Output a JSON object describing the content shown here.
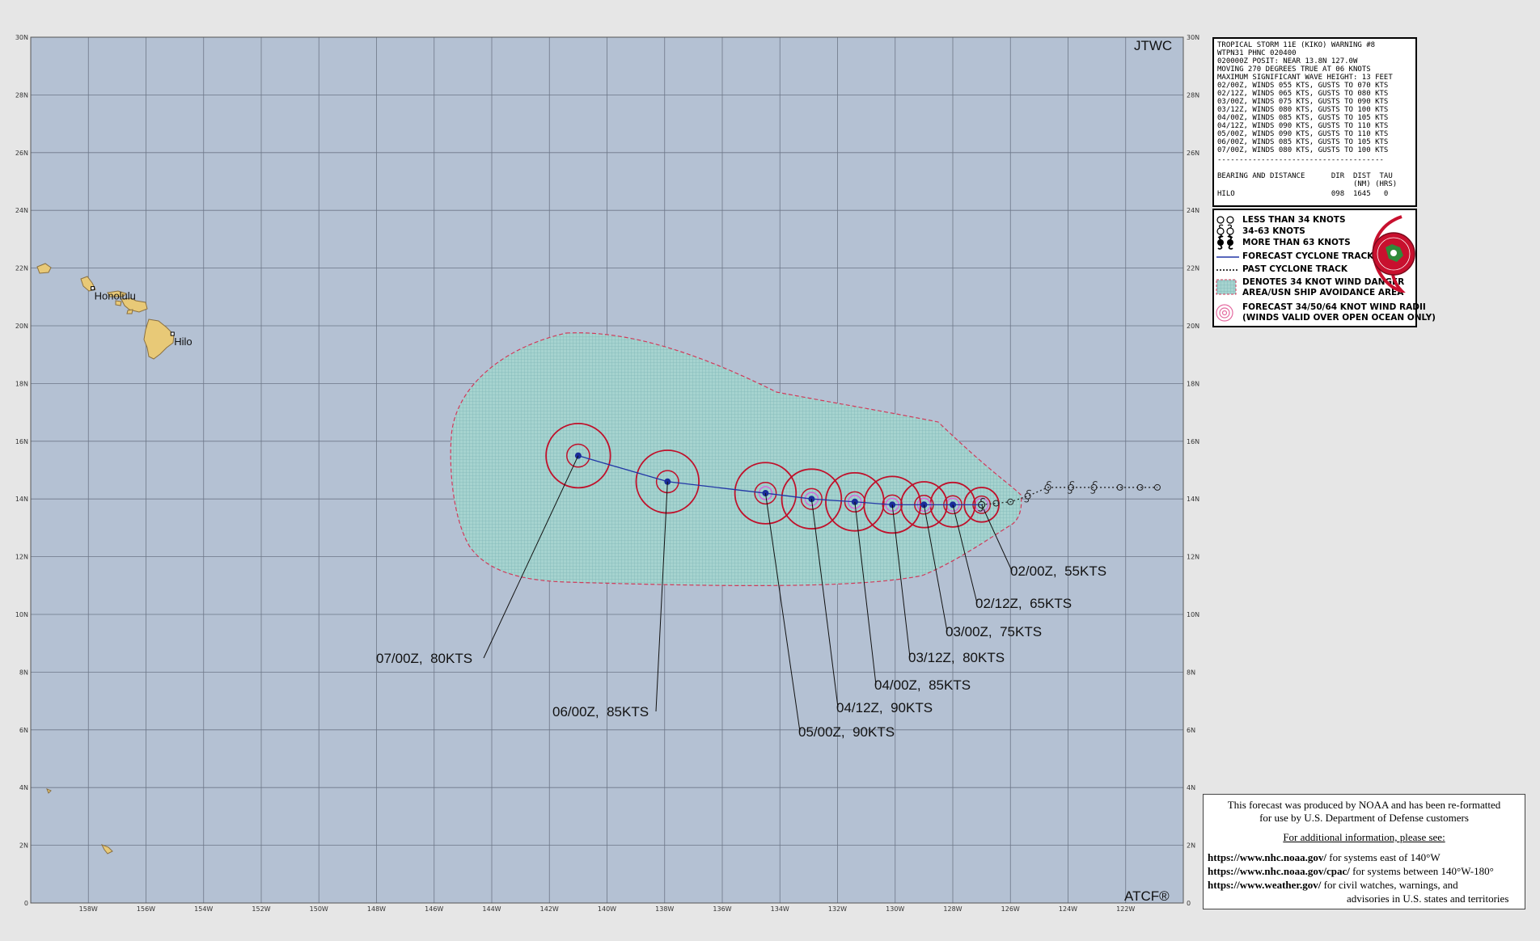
{
  "map": {
    "agency_label": "JTWC",
    "atcf_label": "ATCF®",
    "lat_labels": [
      "0",
      "2N",
      "4N",
      "6N",
      "8N",
      "10N",
      "12N",
      "14N",
      "16N",
      "18N",
      "20N",
      "22N",
      "24N",
      "26N",
      "28N",
      "30N"
    ],
    "lon_labels": [
      "158W",
      "156W",
      "154W",
      "152W",
      "150W",
      "148W",
      "146W",
      "144W",
      "142W",
      "140W",
      "138W",
      "136W",
      "134W",
      "132W",
      "130W",
      "128W",
      "126W",
      "124W",
      "122W"
    ],
    "lon_range": [
      -160,
      -120
    ],
    "lat_range": [
      0,
      30
    ],
    "places": [
      {
        "name": "Honolulu",
        "lat": 21.3,
        "lon": -157.85
      },
      {
        "name": "Hilo",
        "lat": 19.72,
        "lon": -155.08
      }
    ],
    "colors": {
      "ocean": "#b4c1d3",
      "land": "#e8c977",
      "danger_area": "#9fd0cc",
      "track": "#2236a6",
      "radii": "#c0102a"
    }
  },
  "forecast_track": [
    {
      "label": "02/00Z,  55KTS",
      "lat": 13.8,
      "lon": -127.0,
      "kts": 55
    },
    {
      "label": "02/12Z,  65KTS",
      "lat": 13.8,
      "lon": -128.0,
      "kts": 65
    },
    {
      "label": "03/00Z,  75KTS",
      "lat": 13.8,
      "lon": -129.0,
      "kts": 75
    },
    {
      "label": "03/12Z,  80KTS",
      "lat": 13.8,
      "lon": -130.1,
      "kts": 80
    },
    {
      "label": "04/00Z,  85KTS",
      "lat": 13.9,
      "lon": -131.4,
      "kts": 85
    },
    {
      "label": "04/12Z,  90KTS",
      "lat": 14.0,
      "lon": -132.9,
      "kts": 90
    },
    {
      "label": "05/00Z,  90KTS",
      "lat": 14.2,
      "lon": -134.5,
      "kts": 90
    },
    {
      "label": "06/00Z,  85KTS",
      "lat": 14.6,
      "lon": -137.9,
      "kts": 85
    },
    {
      "label": "07/00Z,  80KTS",
      "lat": 15.5,
      "lon": -141.0,
      "kts": 80
    }
  ],
  "past_track": [
    {
      "lat": 13.85,
      "lon": -126.5
    },
    {
      "lat": 13.9,
      "lon": -126.0
    },
    {
      "lat": 14.1,
      "lon": -125.4
    },
    {
      "lat": 14.4,
      "lon": -124.7
    },
    {
      "lat": 14.4,
      "lon": -123.9
    },
    {
      "lat": 14.4,
      "lon": -123.1
    },
    {
      "lat": 14.4,
      "lon": -122.2
    },
    {
      "lat": 14.4,
      "lon": -121.5
    },
    {
      "lat": 14.4,
      "lon": -120.9
    }
  ],
  "warning": {
    "lines": [
      "TROPICAL STORM 11E (KIKO) WARNING #8",
      "WTPN31 PHNC 020400",
      "020000Z POSIT: NEAR 13.8N 127.0W",
      "MOVING 270 DEGREES TRUE AT 06 KNOTS",
      "MAXIMUM SIGNIFICANT WAVE HEIGHT: 13 FEET",
      "02/00Z, WINDS 055 KTS, GUSTS TO 070 KTS",
      "02/12Z, WINDS 065 KTS, GUSTS TO 080 KTS",
      "03/00Z, WINDS 075 KTS, GUSTS TO 090 KTS",
      "03/12Z, WINDS 080 KTS, GUSTS TO 100 KTS",
      "04/00Z, WINDS 085 KTS, GUSTS TO 105 KTS",
      "04/12Z, WINDS 090 KTS, GUSTS TO 110 KTS",
      "05/00Z, WINDS 090 KTS, GUSTS TO 110 KTS",
      "06/00Z, WINDS 085 KTS, GUSTS TO 105 KTS",
      "07/00Z, WINDS 080 KTS, GUSTS TO 100 KTS"
    ],
    "separator": "--------------------------------------",
    "bearing_header": "BEARING AND DISTANCE      DIR  DIST  TAU",
    "bearing_units": "                               (NM) (HRS)",
    "bearing_row": "HILO                      098  1645   0"
  },
  "legend": {
    "items": [
      "LESS THAN 34 KNOTS",
      "34-63 KNOTS",
      "MORE THAN 63 KNOTS",
      "FORECAST CYCLONE TRACK",
      "PAST CYCLONE TRACK",
      "DENOTES 34 KNOT WIND DANGER",
      "AREA/USN SHIP AVOIDANCE AREA",
      "FORECAST 34/50/64 KNOT WIND RADII",
      "(WINDS VALID OVER OPEN OCEAN ONLY)"
    ]
  },
  "info": {
    "line1": "This forecast was produced by NOAA and has been re-formatted",
    "line2": "for use by U.S. Department of Defense customers",
    "line3": "For additional information, please see:",
    "links": [
      {
        "url": "https://www.nhc.noaa.gov/",
        "desc": "  for systems east of 140°W"
      },
      {
        "url": "https://www.nhc.noaa.gov/cpac/",
        "desc": "  for systems between 140°W-180°"
      },
      {
        "url": "https://www.weather.gov/",
        "desc": "  for civil watches, warnings, and"
      }
    ],
    "line_last": "advisories in U.S. states and territories"
  }
}
